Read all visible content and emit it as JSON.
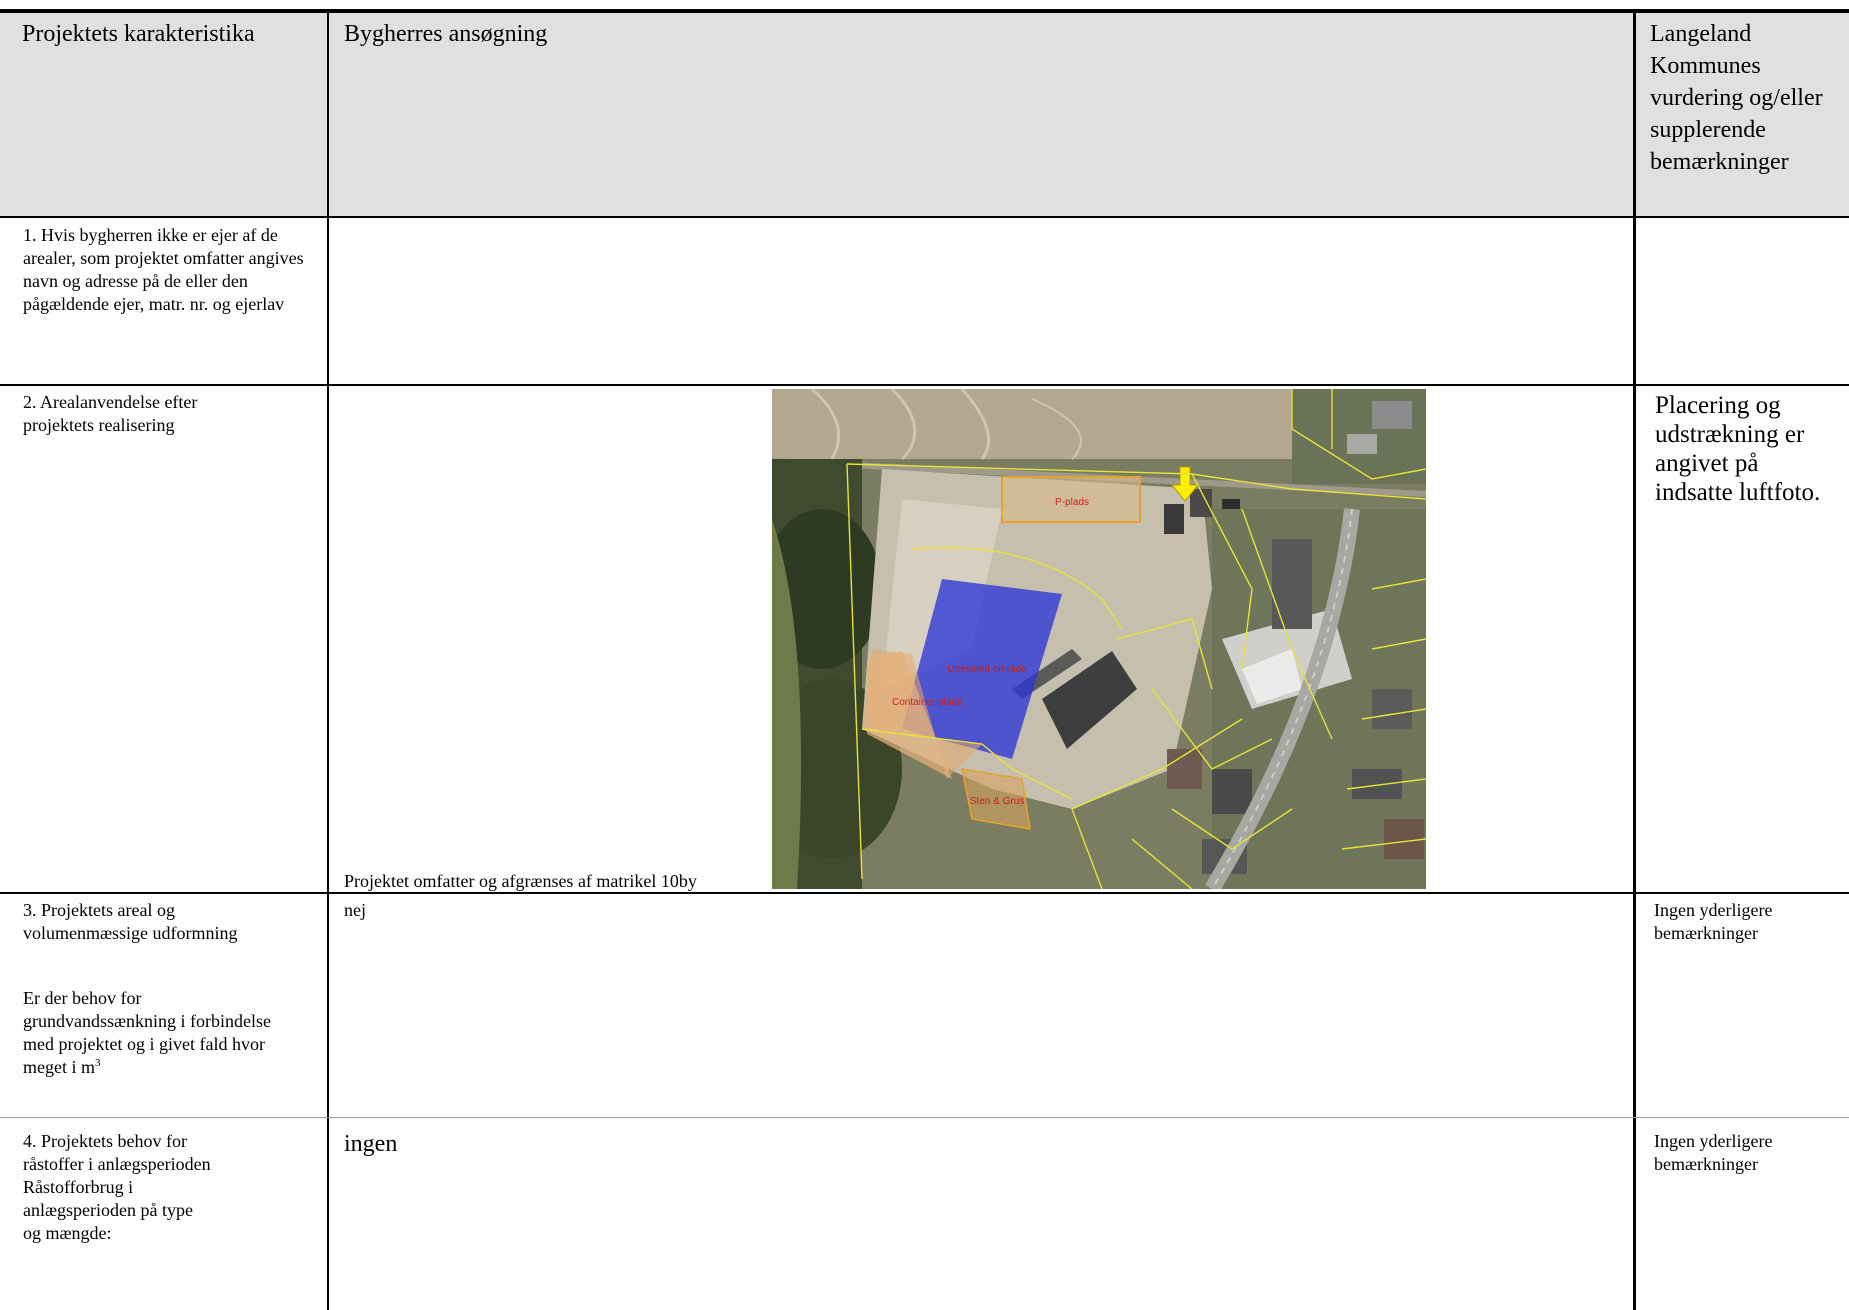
{
  "header": {
    "col1": "Projektets karakteristika",
    "col2": "Bygherres ansøgning",
    "col3": "Langeland Kommunes vurdering og/eller supplerende bemærkninger"
  },
  "rows": [
    {
      "label": "1. Hvis bygherren ikke er ejer af de arealer, som projektet omfatter angives navn og adresse på de eller den pågældende ejer, matr. nr. og ejerlav",
      "application": "",
      "assessment": ""
    },
    {
      "label": "2. Arealanvendelse efter projektets realisering",
      "application": "Projektet omfatter og afgrænses af matrikel 10by",
      "assessment": "Placering og udstrækning er angivet på indsatte luftfoto.",
      "map": {
        "labels": {
          "p_plads": "P-plads",
          "container": "Container plads",
          "sten_grus": "Sten & Grus",
          "blue_area": "Ubestemt område"
        }
      }
    },
    {
      "label_a": "3. Projektets areal og volumenmæssige udformning",
      "label_b": "Er der behov for grundvandssænkning i forbindelse med projektet og i givet fald hvor meget i m",
      "label_b_sup": "3",
      "application": "nej",
      "assessment": "Ingen yderligere bemærkninger"
    },
    {
      "label": "4. Projektets behov for råstoffer i anlægsperioden Råstofforbrug i anlægsperioden på type og mængde:",
      "application": "ingen",
      "assessment": "Ingen yderligere bemærkninger"
    }
  ],
  "colors": {
    "header_bg": "#e0e0e0",
    "rule": "#000000"
  }
}
